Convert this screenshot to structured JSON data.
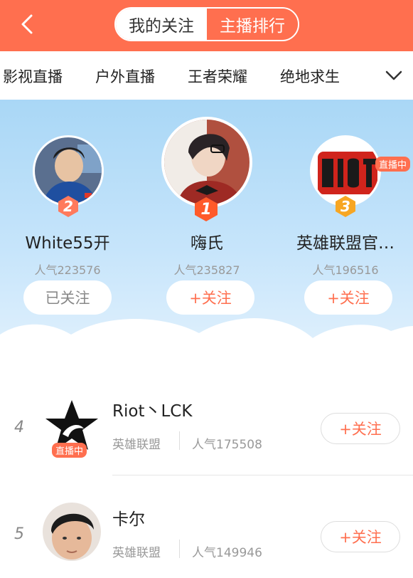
{
  "header": {
    "tabs": [
      {
        "label": "我的关注",
        "active": false
      },
      {
        "label": "主播排行",
        "active": true
      }
    ],
    "accent_color": "#ff6f4f"
  },
  "categories": {
    "items": [
      "影视直播",
      "户外直播",
      "王者荣耀",
      "绝地求生"
    ]
  },
  "podium": [
    {
      "rank": "2",
      "name": "White55开",
      "popularity": "人气223576",
      "follow_label": "已关注",
      "followed": true,
      "badge_color": "#ff7a5c",
      "live_label": ""
    },
    {
      "rank": "1",
      "name": "嗨氏",
      "popularity": "人气235827",
      "follow_label": "+关注",
      "followed": false,
      "badge_color": "#ff5a2a",
      "live_label": ""
    },
    {
      "rank": "3",
      "name": "英雄联盟官…",
      "popularity": "人气196516",
      "follow_label": "+关注",
      "followed": false,
      "badge_color": "#f7a623",
      "live_label": "直播中"
    }
  ],
  "list": [
    {
      "rank": "4",
      "name": "Riot丶LCK",
      "category": "英雄联盟",
      "popularity": "人气175508",
      "follow_label": "+关注",
      "live_label": "直播中"
    },
    {
      "rank": "5",
      "name": "卡尔",
      "category": "英雄联盟",
      "popularity": "人气149946",
      "follow_label": "+关注",
      "live_label": ""
    }
  ]
}
